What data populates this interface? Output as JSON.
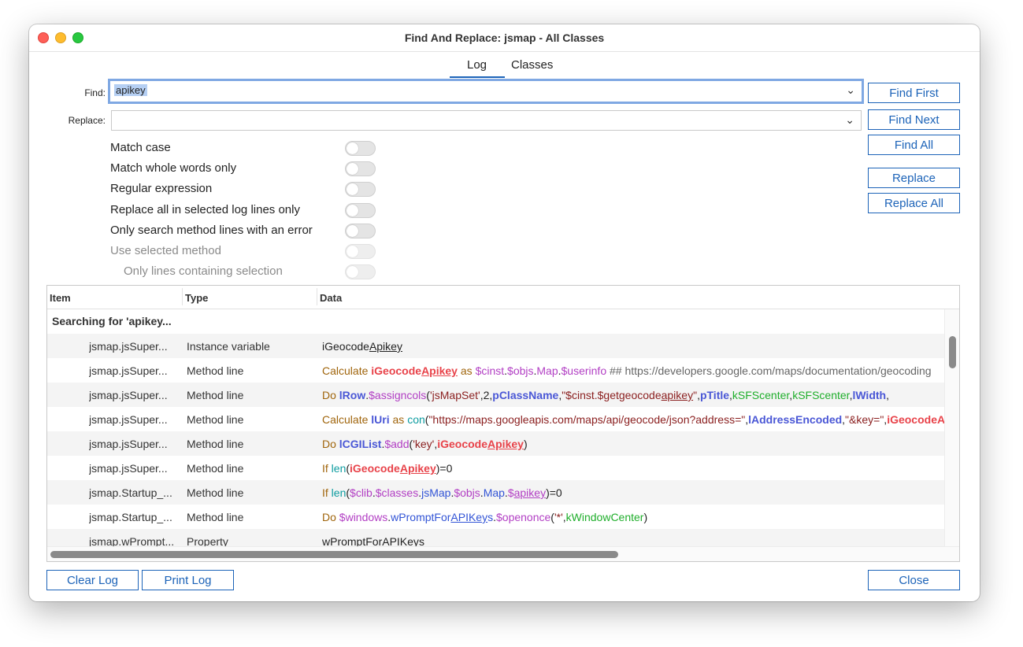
{
  "window": {
    "title": "Find And Replace: jsmap - All Classes"
  },
  "tabs": [
    {
      "label": "Log",
      "active": true
    },
    {
      "label": "Classes",
      "active": false
    }
  ],
  "find": {
    "label": "Find:",
    "value": "apikey"
  },
  "replace": {
    "label": "Replace:",
    "value": ""
  },
  "buttons": {
    "find_first": "Find First",
    "find_next": "Find Next",
    "find_all": "Find All",
    "replace": "Replace",
    "replace_all": "Replace All",
    "clear_log": "Clear Log",
    "print_log": "Print Log",
    "close": "Close"
  },
  "options": [
    {
      "label": "Match case",
      "enabled": true,
      "on": false
    },
    {
      "label": "Match whole words only",
      "enabled": true,
      "on": false
    },
    {
      "label": "Regular expression",
      "enabled": true,
      "on": false
    },
    {
      "label": "Replace all in selected log lines only",
      "enabled": true,
      "on": false
    },
    {
      "label": "Only search method lines with an error",
      "enabled": true,
      "on": false
    },
    {
      "label": "Use selected method",
      "enabled": false,
      "on": false
    },
    {
      "label": "Only lines containing selection",
      "enabled": false,
      "on": false
    }
  ],
  "log": {
    "columns": [
      "Item",
      "Type",
      "Data"
    ],
    "search_label": "Searching for 'apikey...",
    "rows": [
      {
        "item": "jsmap.jsSuper...",
        "type": "Instance variable"
      },
      {
        "item": "jsmap.jsSuper...",
        "type": "Method line"
      },
      {
        "item": "jsmap.jsSuper...",
        "type": "Method line"
      },
      {
        "item": "jsmap.jsSuper...",
        "type": "Method line"
      },
      {
        "item": "jsmap.jsSuper...",
        "type": "Method line"
      },
      {
        "item": "jsmap.jsSuper...",
        "type": "Method line"
      },
      {
        "item": "jsmap.Startup_...",
        "type": "Method line"
      },
      {
        "item": "jsmap.Startup_...",
        "type": "Method line"
      },
      {
        "item": "jsmap.wPrompt...",
        "type": "Property"
      }
    ],
    "data_lines": [
      [
        [
          "k-blk",
          "iGeocode"
        ],
        [
          "k-blk u",
          "Apikey"
        ]
      ],
      [
        [
          "k-cmd",
          "Calculate "
        ],
        [
          "k-red",
          "iGeocode"
        ],
        [
          "k-red u",
          "Apikey"
        ],
        [
          "k-cmd",
          " as "
        ],
        [
          "k-mag",
          "$cinst"
        ],
        [
          "k-blk",
          "."
        ],
        [
          "k-mag",
          "$objs"
        ],
        [
          "k-blk",
          "."
        ],
        [
          "k-mag",
          "Map"
        ],
        [
          "k-blk",
          "."
        ],
        [
          "k-mag",
          "$userinfo"
        ],
        [
          "k-gry",
          " ## https://developers.google.com/maps/documentation/geocoding"
        ]
      ],
      [
        [
          "k-cmd",
          "Do "
        ],
        [
          "k-blb",
          "lRow"
        ],
        [
          "k-blk",
          "."
        ],
        [
          "k-mag",
          "$assigncols"
        ],
        [
          "k-blk",
          "("
        ],
        [
          "k-str",
          "'jsMapSet'"
        ],
        [
          "k-blk",
          ",2,"
        ],
        [
          "k-blb",
          "pClassName"
        ],
        [
          "k-blk",
          ","
        ],
        [
          "k-str",
          "\"$cinst.$getgeocode"
        ],
        [
          "k-str u",
          "apikey"
        ],
        [
          "k-str",
          "\""
        ],
        [
          "k-blk",
          ","
        ],
        [
          "k-blb",
          "pTitle"
        ],
        [
          "k-blk",
          ","
        ],
        [
          "k-grn",
          "kSFScenter"
        ],
        [
          "k-blk",
          ","
        ],
        [
          "k-grn",
          "kSFScenter"
        ],
        [
          "k-blk",
          ","
        ],
        [
          "k-blb",
          "lWidth"
        ],
        [
          "k-blk",
          ","
        ]
      ],
      [
        [
          "k-cmd",
          "Calculate "
        ],
        [
          "k-blb",
          "lUri"
        ],
        [
          "k-cmd",
          " as "
        ],
        [
          "k-tea",
          "con"
        ],
        [
          "k-blk",
          "("
        ],
        [
          "k-str",
          "\"https://maps.googleapis.com/maps/api/geocode/json?address=\""
        ],
        [
          "k-blk",
          ","
        ],
        [
          "k-blb",
          "lAddressEncoded"
        ],
        [
          "k-blk",
          ","
        ],
        [
          "k-str",
          "\"&key=\""
        ],
        [
          "k-blk",
          ","
        ],
        [
          "k-red",
          "iGeocodeApikey"
        ]
      ],
      [
        [
          "k-cmd",
          "Do "
        ],
        [
          "k-blb",
          "lCGIList"
        ],
        [
          "k-blk",
          "."
        ],
        [
          "k-mag",
          "$add"
        ],
        [
          "k-blk",
          "("
        ],
        [
          "k-str",
          "'key'"
        ],
        [
          "k-blk",
          ","
        ],
        [
          "k-red",
          "iGeocode"
        ],
        [
          "k-red u",
          "Apikey"
        ],
        [
          "k-blk",
          ")"
        ]
      ],
      [
        [
          "k-cmd",
          "If "
        ],
        [
          "k-tea",
          "len"
        ],
        [
          "k-blk",
          "("
        ],
        [
          "k-red",
          "iGeocode"
        ],
        [
          "k-red u",
          "Apikey"
        ],
        [
          "k-blk",
          ")=0"
        ]
      ],
      [
        [
          "k-cmd",
          "If "
        ],
        [
          "k-tea",
          "len"
        ],
        [
          "k-blk",
          "("
        ],
        [
          "k-mag",
          "$clib"
        ],
        [
          "k-blk",
          "."
        ],
        [
          "k-mag",
          "$classes"
        ],
        [
          "k-blk",
          "."
        ],
        [
          "k-blu",
          "jsMap"
        ],
        [
          "k-blk",
          "."
        ],
        [
          "k-mag",
          "$objs"
        ],
        [
          "k-blk",
          "."
        ],
        [
          "k-blu",
          "Map"
        ],
        [
          "k-blk",
          "."
        ],
        [
          "k-mag",
          "$"
        ],
        [
          "k-mag u",
          "apikey"
        ],
        [
          "k-blk",
          ")=0"
        ]
      ],
      [
        [
          "k-cmd",
          "Do "
        ],
        [
          "k-mag",
          "$windows"
        ],
        [
          "k-blk",
          "."
        ],
        [
          "k-blu",
          "wPromptFor"
        ],
        [
          "k-blu u",
          "APIKey"
        ],
        [
          "k-blu",
          "s"
        ],
        [
          "k-blk",
          "."
        ],
        [
          "k-mag",
          "$openonce"
        ],
        [
          "k-blk",
          "("
        ],
        [
          "k-str",
          "'*'"
        ],
        [
          "k-blk",
          ","
        ],
        [
          "k-grn",
          "kWindowCenter"
        ],
        [
          "k-blk",
          ")"
        ]
      ],
      [
        [
          "k-blk",
          "wPromptFor"
        ],
        [
          "k-blk u",
          "APIKey"
        ],
        [
          "k-blk",
          "s"
        ]
      ]
    ]
  }
}
